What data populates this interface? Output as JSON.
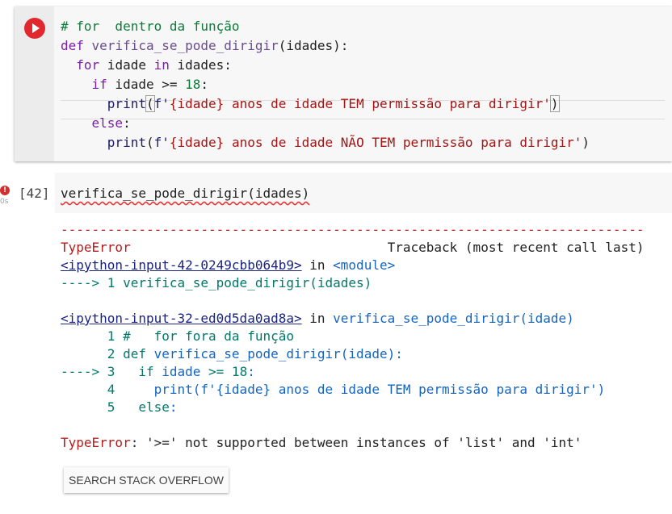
{
  "cell1": {
    "lines": {
      "comment": "# for  dentro da função",
      "def_kw": "def",
      "def_name": "verifica_se_pode_dirigir",
      "def_rest": "(idades):",
      "for_kw": "for",
      "for_mid": " idade ",
      "in_kw": "in",
      "for_rest": " idades:",
      "if_kw": "if",
      "if_mid": " idade >= ",
      "if_num": "18",
      "if_colon": ":",
      "print1_fn": "print",
      "print1_open": "(",
      "print1_f": "f'",
      "print1_str": "{idade} anos de idade TEM permissão para dirigir'",
      "print1_close": ")",
      "else_kw": "else",
      "else_colon": ":",
      "print2_fn": "print",
      "print2_open": "(",
      "print2_f": "f'",
      "print2_str": "{idade} anos de idade NÃO TEM permissão para dirigir'",
      "print2_close": ")"
    }
  },
  "cell2": {
    "error_badge": "!",
    "exec_time": "0s",
    "exec_count": "[42]",
    "code": "verifica_se_pode_dirigir(idades)"
  },
  "output": {
    "dashes": "---------------------------------------------------------------------------",
    "error_type": "TypeError",
    "traceback_label": "Traceback (most recent call last)",
    "input1_link": "<ipython-input-42-0249cbb064b9>",
    "in_word": " in ",
    "module": "<module>",
    "arrow_line1": "----> 1 verifica_se_pode_dirigir(idades)",
    "input2_link": "<ipython-input-32-ed0d5da0ad8a>",
    "in_word2": " in ",
    "func_name": "verifica_se_pode_dirigir",
    "func_args": "(idade)",
    "tb_line1_num": "      1 ",
    "tb_line1_code": "#   for fora da função",
    "tb_line2_num": "      2 ",
    "tb_line2_def": "def",
    "tb_line2_code": " verifica_se_pode_dirigir(idade):",
    "tb_line3_arrow": "----> 3 ",
    "tb_line3_if": "  if",
    "tb_line3_code": " idade ",
    "tb_line3_op": ">=",
    "tb_line3_num": " 18",
    "tb_line3_colon": ":",
    "tb_line4_num": "      4 ",
    "tb_line4_print": "    print(f'",
    "tb_line4_str": "{idade} anos de idade TEM permissão para dirigir'",
    "tb_line4_close": ")",
    "tb_line5_num": "      5 ",
    "tb_line5_else": "  else",
    "tb_line5_colon": ":",
    "final_type": "TypeError",
    "final_msg": ": '>=' not supported between instances of 'list' and 'int'"
  },
  "search_button": {
    "label": "SEARCH STACK OVERFLOW"
  },
  "icons": {
    "run": "play-circle-icon",
    "error": "error-circle-icon"
  },
  "colors": {
    "run_button": "#e0282e",
    "error_red": "#b71c1c",
    "link_blue": "#1565c0"
  }
}
